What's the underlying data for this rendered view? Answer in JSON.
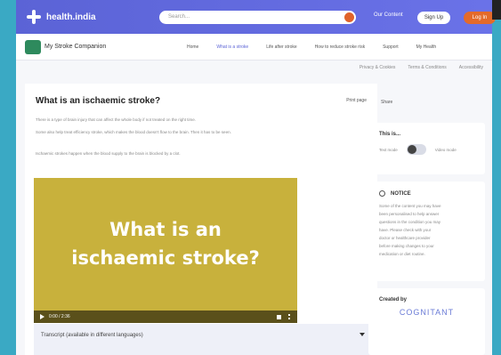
{
  "topbar": {
    "brand": "health.india",
    "search_placeholder": "Search...",
    "link": "Our Content",
    "signup": "Sign Up",
    "login": "Log In"
  },
  "nav": {
    "site_name": "My Stroke Companion",
    "items": [
      "Home",
      "What is a stroke",
      "Life after stroke",
      "How to reduce stroke risk",
      "Support",
      "My Health"
    ]
  },
  "subnav": [
    "Privacy & Cookies",
    "Terms & Conditions",
    "Accessibility"
  ],
  "article": {
    "title": "What is an ischaemic stroke?",
    "print": "Print page",
    "paragraphs": [
      "There is a type of brain injury that can affect the whole body if not treated on the right time.",
      "Some also help treat efficiency stroke, which makes the blood doesn't flow to the brain. Then it has to be seen.",
      "Ischaemic strokes happen when the blood supply to the brain is blocked by a clot."
    ]
  },
  "video": {
    "title_line1": "What is an",
    "title_line2": "ischaemic stroke?",
    "time": "0:00 / 2:36"
  },
  "transcript": "Transcript (available in different languages)",
  "sidebar": {
    "share": "Share",
    "toggle_heading": "This is...",
    "toggle_left": "Text mode",
    "toggle_right": "Video mode",
    "notice_heading": "NOTICE",
    "notice_lines": [
      "Some of the content you may have",
      "been personalised to help answer",
      "questions in the condition you may",
      "have. Please check with your",
      "doctor or healthcare provider",
      "before making changes to your",
      "medication or diet routine."
    ],
    "created_heading": "Created by",
    "created_brand": "COGNITANT"
  },
  "colors": {
    "accent": "#5b63d6",
    "orange": "#e46a2a",
    "video": "#c8b13c"
  }
}
